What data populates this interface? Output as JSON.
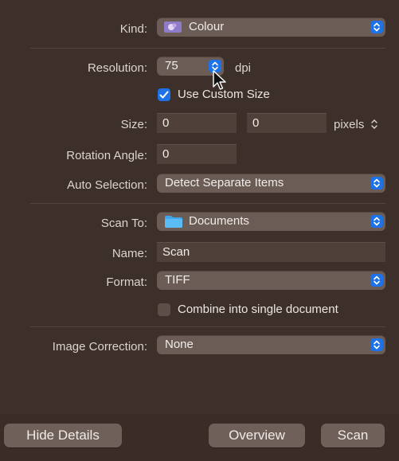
{
  "kind": {
    "label": "Kind:",
    "value": "Colour",
    "icon": "colour-swatch-icon"
  },
  "resolution": {
    "label": "Resolution:",
    "value": "75",
    "unit": "dpi"
  },
  "custom_size": {
    "label": "Use Custom Size",
    "checked": true
  },
  "size": {
    "label": "Size:",
    "width": "0",
    "height": "0",
    "unit": "pixels"
  },
  "rotation": {
    "label": "Rotation Angle:",
    "value": "0"
  },
  "auto_selection": {
    "label": "Auto Selection:",
    "value": "Detect Separate Items"
  },
  "scan_to": {
    "label": "Scan To:",
    "value": "Documents",
    "icon": "folder-icon"
  },
  "name": {
    "label": "Name:",
    "value": "Scan"
  },
  "format": {
    "label": "Format:",
    "value": "TIFF"
  },
  "combine": {
    "label": "Combine into single document",
    "checked": false
  },
  "image_correction": {
    "label": "Image Correction:",
    "value": "None"
  },
  "buttons": {
    "hide_details": "Hide Details",
    "overview": "Overview",
    "scan": "Scan"
  },
  "colors": {
    "accent": "#1d72e8",
    "background": "#3d2f29",
    "control": "#6b5c55"
  }
}
